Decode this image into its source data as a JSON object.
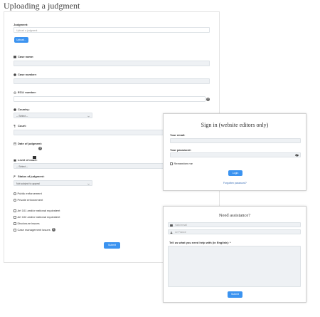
{
  "page_title": "Uploading a judgment",
  "upload_form": {
    "judgment_label": "Judgment:",
    "judgment_placeholder": "Upload a judgment",
    "upload_button": "Upload...",
    "case_name_label": "Case name:",
    "case_number_label": "Case number:",
    "ecli_label": "ECLI number:",
    "country_label": "Country:",
    "country_select": "-- Select --",
    "court_label": "Court:",
    "date_label": "Date of judgment:",
    "level_label": "Level of court:",
    "level_select": "-- Select --",
    "status_label": "Status of judgment:",
    "status_select": "Not subject to appeal",
    "public_enforcement": "Public enforcement",
    "private_enforcement": "Private enforcement",
    "art101": "Art 101 and/or national equivalent",
    "art102": "Art 102 and/or national equivalent",
    "disclosure": "Disclosure issues",
    "case_mgmt": "Case management issues",
    "help_mark": "?",
    "submit_button": "Submit"
  },
  "signin": {
    "title": "Sign in (website editors only)",
    "email_label": "Your email:",
    "password_label": "Your password:",
    "remember_me": "Remember me",
    "login_button": "Login",
    "forgot_link": "Forgotten password?"
  },
  "assistance": {
    "title": "Need assistance?",
    "email_placeholder": "Valid email",
    "name_placeholder": "Le France",
    "message_label": "Tell us what you need help with (in English): *",
    "submit_button": "Submit"
  },
  "colors": {
    "accent": "#3b93f0",
    "field_bg": "#eef1f4"
  }
}
